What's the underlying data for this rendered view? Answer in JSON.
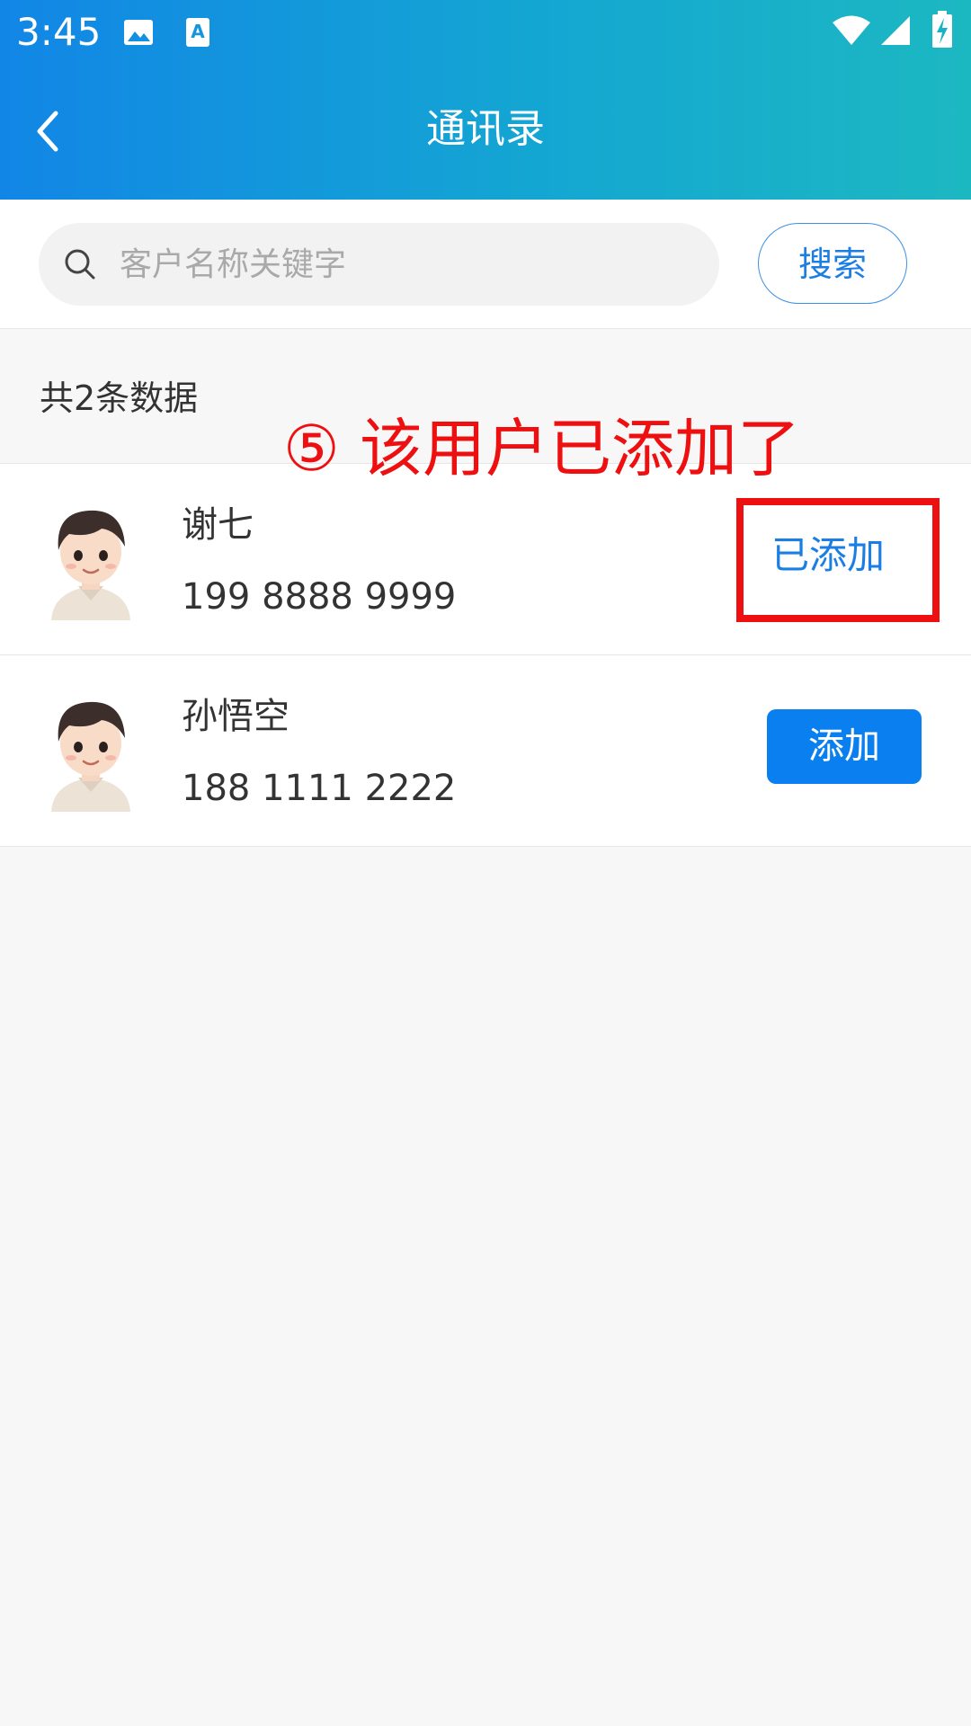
{
  "status_bar": {
    "time": "3:45",
    "icons": [
      "image-icon",
      "text-a-icon",
      "wifi-icon",
      "signal-icon",
      "battery-charging-icon"
    ]
  },
  "nav": {
    "back_icon": "chevron-left-icon",
    "title": "通讯录"
  },
  "search": {
    "placeholder": "客户名称关键字",
    "value": "",
    "button_label": "搜索"
  },
  "list": {
    "count_label": "共2条数据",
    "contacts": [
      {
        "name": "谢七",
        "phone": "199 8888 9999",
        "action_label": "已添加",
        "added": true
      },
      {
        "name": "孙悟空",
        "phone": "188 1111 2222",
        "action_label": "添加",
        "added": false
      }
    ]
  },
  "annotation": {
    "text": "⑤ 该用户已添加了",
    "color": "#ee1010"
  },
  "colors": {
    "header_start": "#1286e6",
    "header_end": "#1cb8c2",
    "accent": "#0a7ff0",
    "annotation_red": "#ee1010"
  }
}
